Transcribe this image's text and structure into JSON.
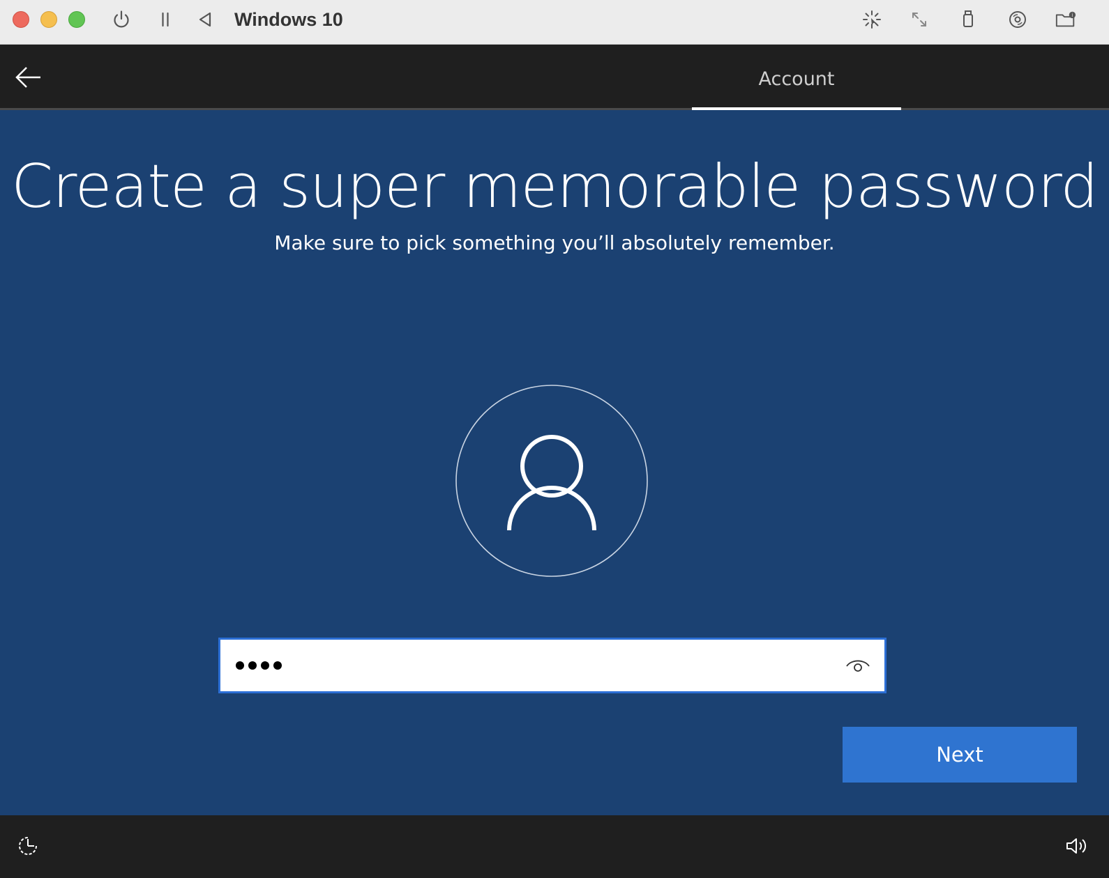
{
  "titlebar": {
    "title": "Windows 10",
    "left_controls": [
      "power-icon",
      "pause-icon",
      "back-triangle-icon"
    ],
    "right_controls": [
      "pointer-capture-icon",
      "resize-icon",
      "usb-icon",
      "disc-icon",
      "shared-folder-icon"
    ],
    "traffic_colors": {
      "close": "#ed6a5e",
      "minimize": "#f5bf4f",
      "zoom": "#61c554"
    }
  },
  "oobe_header": {
    "back_icon": "back-arrow-icon",
    "active_tab": "Account"
  },
  "main": {
    "title": "Create a super memorable password",
    "subtitle": "Make sure to pick something you’ll absolutely remember.",
    "avatar_icon": "user-icon",
    "password": {
      "masked_length": 4,
      "reveal_icon": "eye-icon"
    },
    "next_label": "Next",
    "background_color": "#1b4172",
    "accent_color": "#2f74d0"
  },
  "footer": {
    "left_icon": "ease-of-access-icon",
    "right_icon": "volume-icon"
  }
}
